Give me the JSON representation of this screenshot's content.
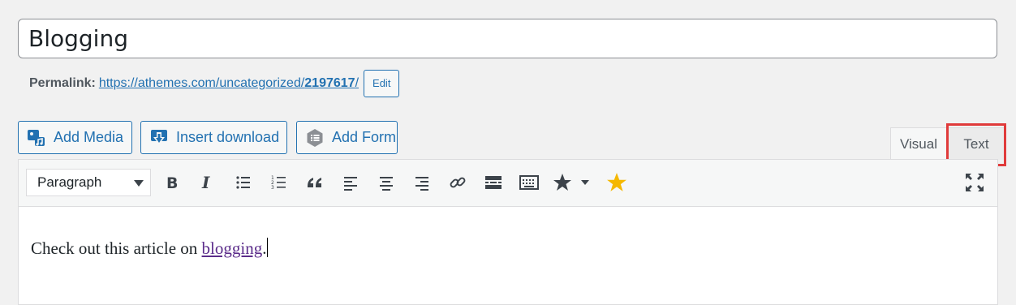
{
  "post": {
    "title": "Blogging"
  },
  "permalink": {
    "label": "Permalink:",
    "url_prefix": "https://athemes.com/uncategorized/",
    "url_slug": "2197617",
    "url_suffix": "/",
    "edit_label": "Edit"
  },
  "media_buttons": [
    {
      "label": "Add Media",
      "icon": "add-media-icon"
    },
    {
      "label": "Insert download",
      "icon": "download-icon"
    },
    {
      "label": "Add Form",
      "icon": "form-icon"
    }
  ],
  "editor_tabs": {
    "visual": "Visual",
    "text": "Text",
    "highlighted": "text"
  },
  "toolbar": {
    "format_value": "Paragraph",
    "buttons": [
      "bold-icon",
      "italic-icon",
      "bulleted-list-icon",
      "numbered-list-icon",
      "blockquote-icon",
      "align-left-icon",
      "align-center-icon",
      "align-right-icon",
      "link-icon",
      "read-more-icon",
      "toolbar-toggle-icon",
      "star-dropdown-icon",
      "star-icon",
      "fullscreen-icon"
    ]
  },
  "content": {
    "text_before": "Check out this article on ",
    "link_text": "blogging",
    "text_after": "."
  },
  "colors": {
    "accent": "#2271b1",
    "highlight": "#e03b3b",
    "star": "#f5b800",
    "visited_link": "#5b2c8a"
  }
}
